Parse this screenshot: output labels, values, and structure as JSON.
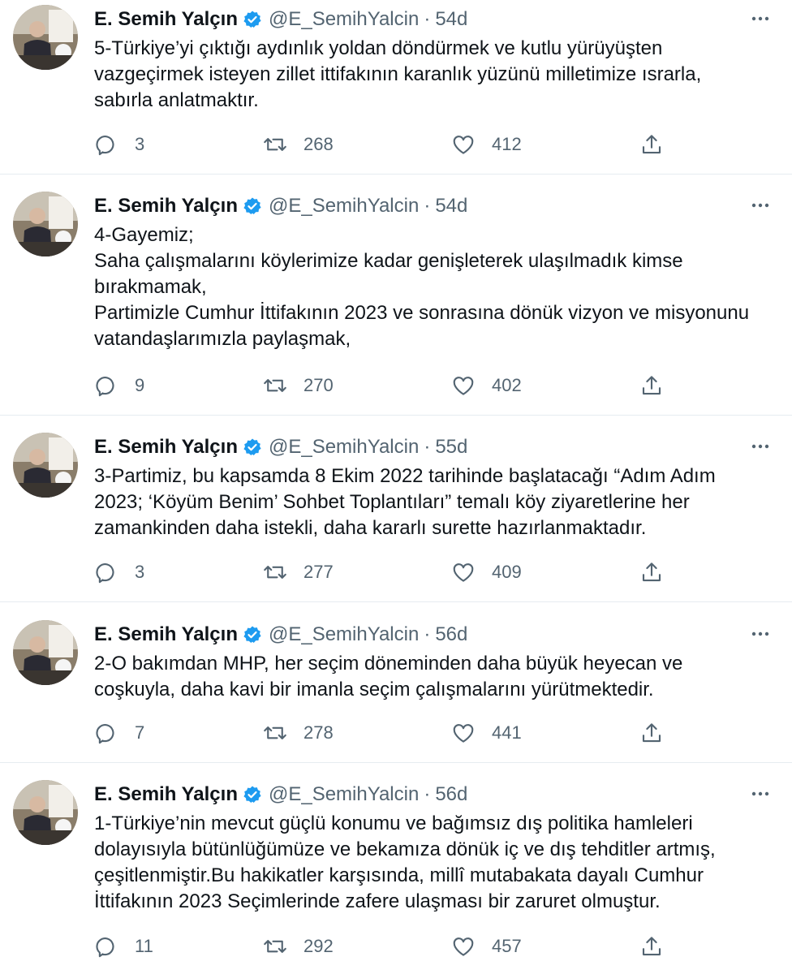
{
  "author": {
    "name": "E. Semih Yalçın",
    "handle": "@E_SemihYalcin",
    "verified_icon": "verified-badge-icon",
    "separator": "·"
  },
  "colors": {
    "text": "#0f1419",
    "muted": "#536471",
    "verified": "#1d9bf0",
    "divider": "#e6ecf0"
  },
  "tweets": [
    {
      "time": "54d",
      "lines": [
        "5-Türkiye’yi çıktığı aydınlık yoldan döndürmek ve kutlu yürüyüşten",
        "vazgeçirmek isteyen zillet ittifakının karanlık yüzünü milletimize ısrarla,",
        "sabırla anlatmaktır."
      ],
      "replies": "3",
      "retweets": "268",
      "likes": "412"
    },
    {
      "time": "54d",
      "lines": [
        "4-Gayemiz;",
        "Saha çalışmalarını köylerimize kadar genişleterek ulaşılmadık kimse",
        "bırakmamak,",
        "Partimizle Cumhur İttifakının 2023 ve sonrasına dönük vizyon ve misyonunu",
        "vatandaşlarımızla paylaşmak,"
      ],
      "replies": "9",
      "retweets": "270",
      "likes": "402"
    },
    {
      "time": "55d",
      "lines": [
        "3-Partimiz, bu kapsamda 8 Ekim 2022 tarihinde başlatacağı “Adım Adım",
        "2023; ‘Köyüm Benim’ Sohbet Toplantıları” temalı köy ziyaretlerine her",
        "zamankinden daha istekli, daha kararlı surette hazırlanmaktadır."
      ],
      "replies": "3",
      "retweets": "277",
      "likes": "409"
    },
    {
      "time": "56d",
      "lines": [
        "2-O bakımdan MHP, her seçim döneminden daha büyük heyecan ve",
        "coşkuyla, daha kavi bir imanla seçim çalışmalarını yürütmektedir."
      ],
      "replies": "7",
      "retweets": "278",
      "likes": "441"
    },
    {
      "time": "56d",
      "lines": [
        "1-Türkiye’nin mevcut güçlü konumu ve bağımsız dış politika hamleleri",
        "dolayısıyla bütünlüğümüze ve bekamıza dönük iç ve dış tehditler artmış,",
        "çeşitlenmiştir.Bu hakikatler karşısında, millî mutabakata dayalı Cumhur",
        "İttifakının 2023 Seçimlerinde zafere ulaşması bir zaruret olmuştur."
      ],
      "replies": "11",
      "retweets": "292",
      "likes": "457"
    }
  ]
}
